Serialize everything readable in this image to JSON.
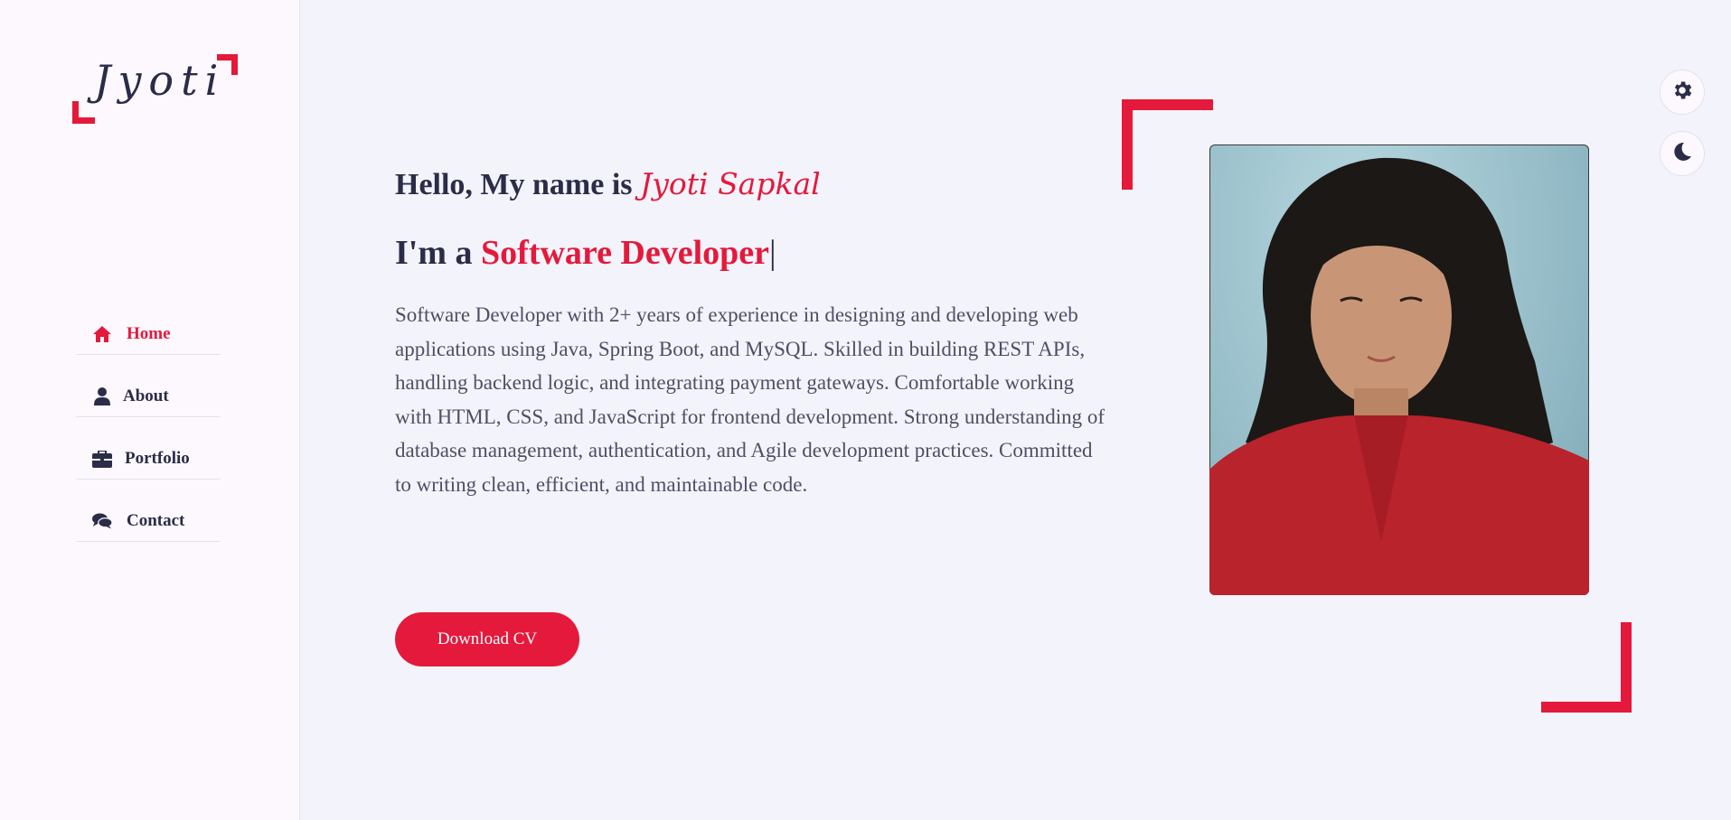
{
  "logo": {
    "text": "Jyoti"
  },
  "nav": {
    "items": [
      {
        "label": "Home",
        "icon": "home-icon",
        "active": true
      },
      {
        "label": "About",
        "icon": "user-icon",
        "active": false
      },
      {
        "label": "Portfolio",
        "icon": "briefcase-icon",
        "active": false
      },
      {
        "label": "Contact",
        "icon": "comments-icon",
        "active": false
      }
    ]
  },
  "hero": {
    "greeting_prefix": "Hello, My name is",
    "name": "Jyoti Sapkal",
    "role_prefix": "I'm a",
    "role": "Software Developer",
    "cursor": "|",
    "bio": "Software Developer with 2+ years of experience in designing and developing web applications using Java, Spring Boot, and MySQL. Skilled in building REST APIs, handling backend logic, and integrating payment gateways. Comfortable working with HTML, CSS, and JavaScript for frontend development. Strong understanding of database management, authentication, and Agile development practices. Committed to writing clean, efficient, and maintainable code.",
    "cv_button": "Download CV"
  },
  "floating_buttons": {
    "settings_icon": "gear-icon",
    "theme_icon": "moon-icon"
  },
  "colors": {
    "accent": "#e5193b",
    "text": "#2b2c48",
    "background": "#f2f3fb",
    "sidebar": "#fcf8fd"
  }
}
